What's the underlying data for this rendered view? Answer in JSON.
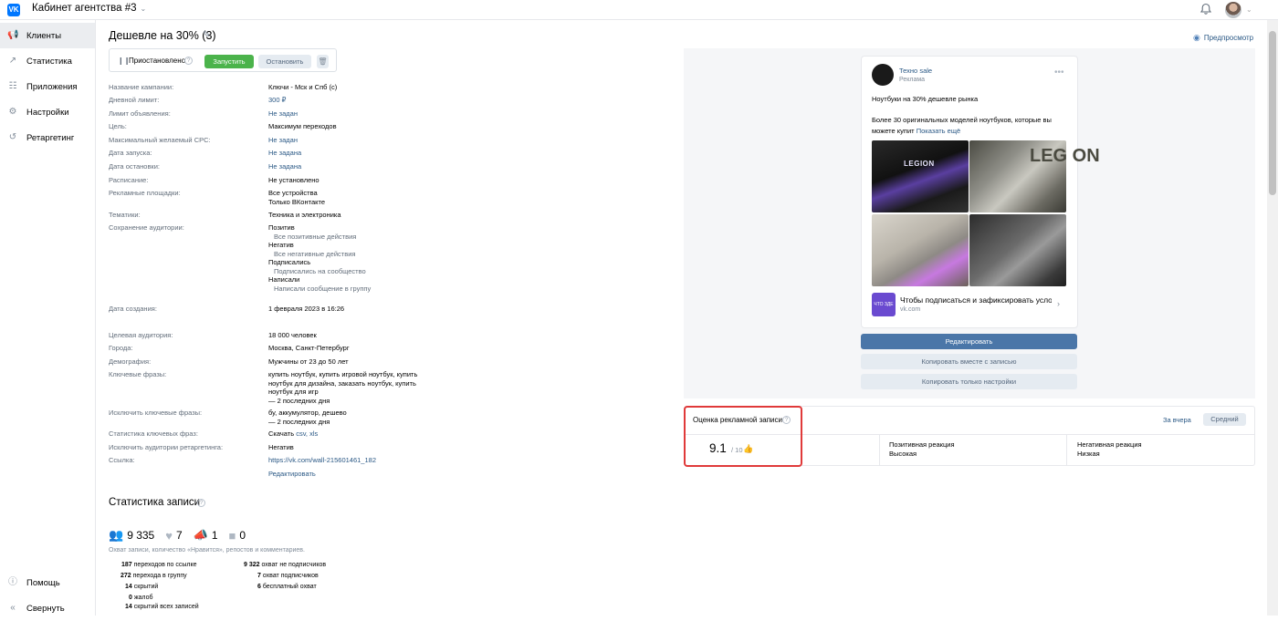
{
  "header": {
    "cabinet_title": "Кабинет агентства #3"
  },
  "sidebar": {
    "items": [
      {
        "label": "Клиенты"
      },
      {
        "label": "Статистика"
      },
      {
        "label": "Приложения"
      },
      {
        "label": "Настройки"
      },
      {
        "label": "Ретаргетинг"
      }
    ],
    "help_label": "Помощь",
    "collapse_label": "Свернуть"
  },
  "campaign": {
    "title": "Дешевле на 30% (3)",
    "preview_label": "Предпросмотр",
    "status": "Приостановлено",
    "run_label": "Запустить",
    "stop_label": "Остановить"
  },
  "params": [
    {
      "label": "Название кампании:",
      "value": "Ключи - Мск и Спб (c)"
    },
    {
      "label": "Дневной лимит:",
      "value": "300 ₽"
    },
    {
      "label": "Лимит объявления:",
      "value": "Не задан"
    },
    {
      "label": "Цель:",
      "value": "Максимум переходов"
    },
    {
      "label": "Максимальный желаемый CPC:",
      "value": "Не задан"
    },
    {
      "label": "Дата запуска:",
      "value": "Не задана"
    },
    {
      "label": "Дата остановки:",
      "value": "Не задана"
    },
    {
      "label": "Расписание:",
      "value": "Не установлено"
    },
    {
      "label": "Рекламные площадки:",
      "value": "Все устройства",
      "value2": "Только ВКонтакте"
    },
    {
      "label": "Тематики:",
      "value": "Техника и электроника"
    },
    {
      "label": "Сохранение аудитории:",
      "groups": [
        {
          "name": "Позитив",
          "sub": "Все позитивные действия"
        },
        {
          "name": "Негатив",
          "sub": "Все негативные действия"
        },
        {
          "name": "Подписались",
          "sub": "Подписались на сообщество"
        },
        {
          "name": "Написали",
          "sub": "Написали сообщение в группу"
        }
      ]
    },
    {
      "label": "Дата создания:",
      "value": "1 февраля 2023 в 16:26"
    },
    {
      "label": "Целевая аудитория:",
      "value": "18 000 человек"
    },
    {
      "label": "Города:",
      "value": "Москва, Санкт-Петербург"
    },
    {
      "label": "Демография:",
      "value": "Мужчины от 23 до 50 лет"
    },
    {
      "label": "Ключевые фразы:",
      "lines": [
        "купить ноутбук, купить игровой ноутбук, купить",
        "ноутбук для дизайна, заказать ноутбук, купить",
        "ноутбук для игр",
        "— 2 последних дня"
      ]
    },
    {
      "label": "Исключить ключевые фразы:",
      "lines": [
        "бу, аккумулятор, дешево",
        "— 2 последних дня"
      ]
    },
    {
      "label": "Статистика ключевых фраз:",
      "value": "Скачать",
      "links": "csv, xls"
    },
    {
      "label": "Исключить аудитории ретаргетинга:",
      "value": "Негатив"
    },
    {
      "label": "Ссылка:",
      "value": "https://vk.com/wall-215601461_182"
    },
    {
      "value": "Редактировать"
    }
  ],
  "stats": {
    "title": "Статистика записи",
    "reach": "9 335",
    "likes": "7",
    "reposts": "1",
    "comments": "0",
    "caption": "Охват записи, количество «Нравится», репостов и комментариев.",
    "left": [
      {
        "n": "187",
        "t": "переходов по ссылке"
      },
      {
        "n": "272",
        "t": "перехода в группу"
      },
      {
        "n": "14",
        "t": "скрытий"
      },
      {
        "n": "0",
        "t": "жалоб"
      },
      {
        "n": "14",
        "t": "скрытий всех записей"
      }
    ],
    "right": [
      {
        "n": "9 322",
        "t": "охват не подписчиков"
      },
      {
        "n": "7",
        "t": "охват подписчиков"
      },
      {
        "n": "6",
        "t": "бесплатный охват"
      }
    ]
  },
  "post": {
    "author": "Техно sale",
    "subtitle": "Реклама",
    "text1": "Ноутбуки на 30% дешевле рынка",
    "text2": "Более 30 оригинальных моделей ноутбуков, которые вы можете купит",
    "more": "Показать ещё",
    "photo1_text": "LEGION",
    "photo2_text": "LEG ON",
    "link_thumb_text": "ЧТО ЗДЕ",
    "link_title": "Чтобы подписаться и зафиксировать усло...",
    "link_domain": "vk.com"
  },
  "actions": {
    "edit": "Редактировать",
    "copy_with_post": "Копировать вместе с записью",
    "copy_settings": "Копировать только настройки"
  },
  "rating": {
    "title": "Оценка рекламной записи",
    "period": "За вчера",
    "level": "Средний",
    "score": "9.1",
    "out_of": "/ 10",
    "positive_label": "Позитивная реакция",
    "positive_value": "Высокая",
    "negative_label": "Негативная реакция",
    "negative_value": "Низкая",
    "highlight_color": "#e03a3a"
  }
}
